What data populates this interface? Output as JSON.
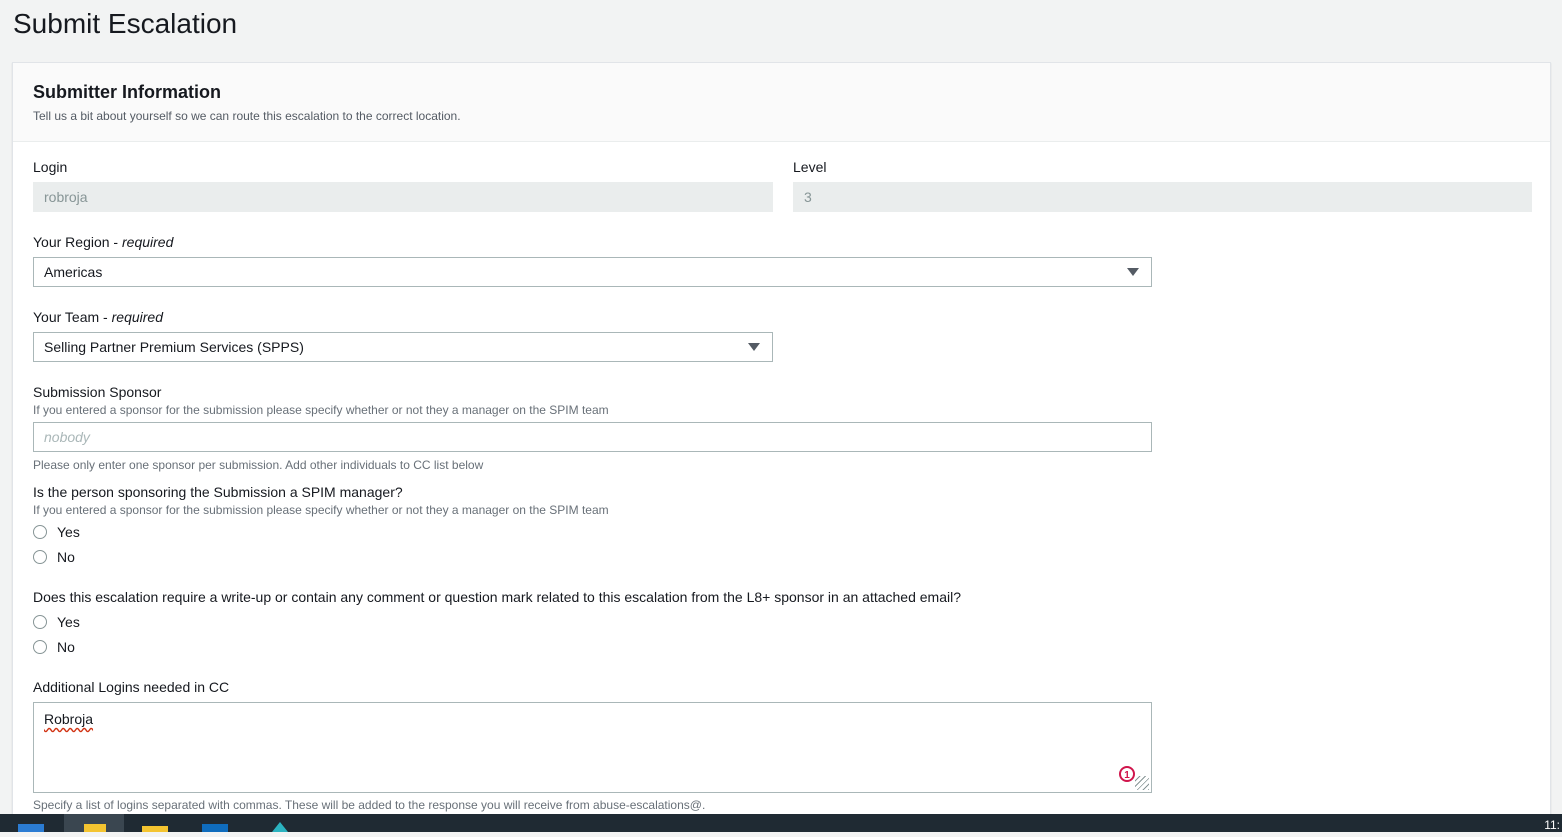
{
  "page": {
    "title": "Submit Escalation"
  },
  "section": {
    "title": "Submitter Information",
    "description": "Tell us a bit about yourself so we can route this escalation to the correct location."
  },
  "fields": {
    "login": {
      "label": "Login",
      "value": "robroja"
    },
    "level": {
      "label": "Level",
      "value": "3"
    },
    "region": {
      "label": "Your Region",
      "required": "required",
      "value": "Americas"
    },
    "team": {
      "label": "Your Team",
      "required": "required",
      "value": "Selling Partner Premium Services (SPPS)"
    },
    "sponsor": {
      "label": "Submission Sponsor",
      "description": "If you entered a sponsor for the submission please specify whether or not they a manager on the SPIM team",
      "placeholder": "nobody",
      "hint": "Please only enter one sponsor per submission. Add other individuals to CC list below"
    },
    "spim_manager": {
      "label": "Is the person sponsoring the Submission a SPIM manager?",
      "description": "If you entered a sponsor for the submission please specify whether or not they a manager on the SPIM team",
      "options": [
        "Yes",
        "No"
      ]
    },
    "writeup": {
      "label": "Does this escalation require a write-up or contain any comment or question mark related to this escalation from the L8+ sponsor in an attached email?",
      "options": [
        "Yes",
        "No"
      ]
    },
    "cc": {
      "label": "Additional Logins needed in CC",
      "value": "Robroja",
      "badge_count": "1",
      "hint": "Specify a list of logins separated with commas. These will be added to the response you will receive from abuse-escalations@."
    }
  },
  "taskbar": {
    "clock": "11:",
    "colors": {
      "start": "#2b7cd3",
      "folder": "#f4c430",
      "outlook": "#0f6cbd",
      "app": "#2bb3c0"
    }
  }
}
